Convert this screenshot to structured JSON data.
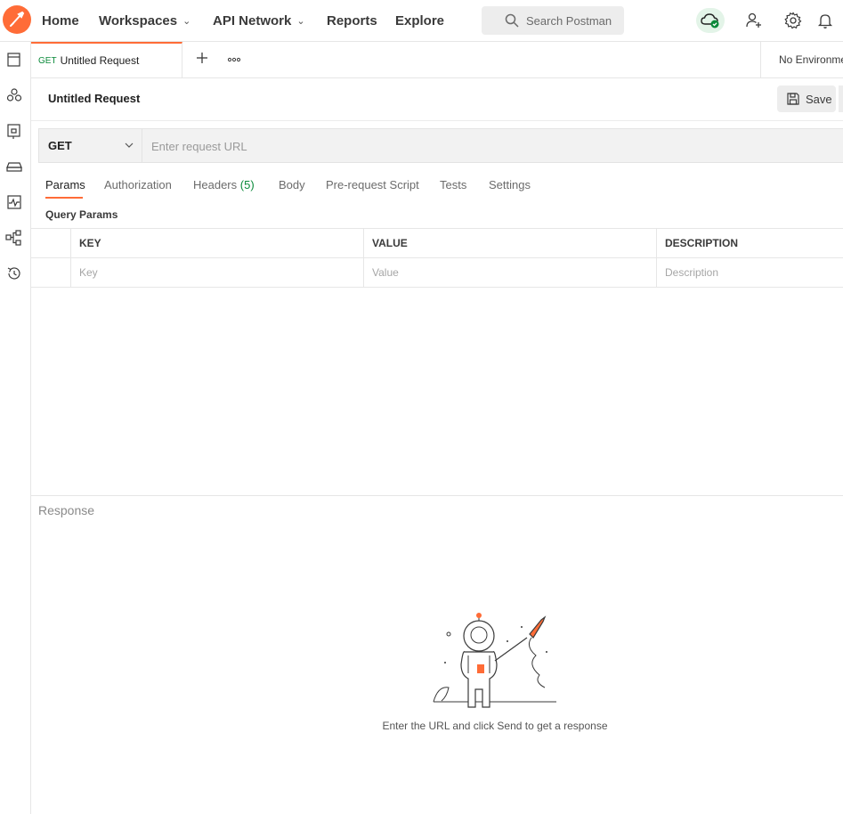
{
  "colors": {
    "accent": "#ff6c37",
    "get_method": "#0b8a3a",
    "sync_ok": "#0b8a3a"
  },
  "header": {
    "nav": [
      {
        "label": "Home",
        "dropdown": false
      },
      {
        "label": "Workspaces",
        "dropdown": true
      },
      {
        "label": "API Network",
        "dropdown": true
      },
      {
        "label": "Reports",
        "dropdown": false
      },
      {
        "label": "Explore",
        "dropdown": false
      }
    ],
    "search_placeholder": "Search Postman",
    "icons": [
      "postman-logo-icon",
      "cloud-sync-icon",
      "invite-user-icon",
      "settings-gear-icon",
      "notifications-bell-icon"
    ]
  },
  "sidebar": {
    "icons": [
      "collections-icon",
      "apis-icon",
      "environments-icon",
      "mock-servers-icon",
      "monitors-icon",
      "flows-icon",
      "history-icon"
    ]
  },
  "tabs": {
    "active_tab": {
      "method": "GET",
      "name": "Untitled Request"
    },
    "environment": "No Environment"
  },
  "request": {
    "title": "Untitled Request",
    "save_label": "Save",
    "method": "GET",
    "url_placeholder": "Enter request URL",
    "subtabs": [
      "Params",
      "Authorization",
      "Headers",
      "Body",
      "Pre-request Script",
      "Tests",
      "Settings"
    ],
    "headers_count": "(5)",
    "active_subtab": "Params",
    "query_params_label": "Query Params",
    "columns": [
      "KEY",
      "VALUE",
      "DESCRIPTION"
    ],
    "placeholders": [
      "Key",
      "Value",
      "Description"
    ]
  },
  "response": {
    "label": "Response",
    "empty_message": "Enter the URL and click Send to get a response"
  }
}
